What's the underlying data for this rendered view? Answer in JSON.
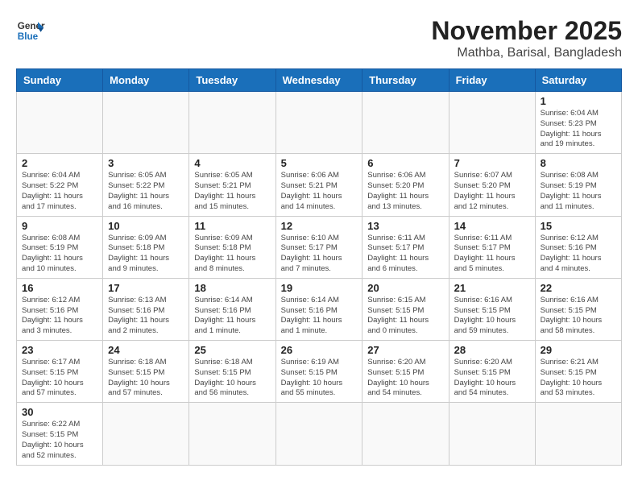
{
  "header": {
    "logo_general": "General",
    "logo_blue": "Blue",
    "title": "November 2025",
    "subtitle": "Mathba, Barisal, Bangladesh"
  },
  "weekdays": [
    "Sunday",
    "Monday",
    "Tuesday",
    "Wednesday",
    "Thursday",
    "Friday",
    "Saturday"
  ],
  "weeks": [
    [
      {
        "day": "",
        "info": ""
      },
      {
        "day": "",
        "info": ""
      },
      {
        "day": "",
        "info": ""
      },
      {
        "day": "",
        "info": ""
      },
      {
        "day": "",
        "info": ""
      },
      {
        "day": "",
        "info": ""
      },
      {
        "day": "1",
        "info": "Sunrise: 6:04 AM\nSunset: 5:23 PM\nDaylight: 11 hours\nand 19 minutes."
      }
    ],
    [
      {
        "day": "2",
        "info": "Sunrise: 6:04 AM\nSunset: 5:22 PM\nDaylight: 11 hours\nand 17 minutes."
      },
      {
        "day": "3",
        "info": "Sunrise: 6:05 AM\nSunset: 5:22 PM\nDaylight: 11 hours\nand 16 minutes."
      },
      {
        "day": "4",
        "info": "Sunrise: 6:05 AM\nSunset: 5:21 PM\nDaylight: 11 hours\nand 15 minutes."
      },
      {
        "day": "5",
        "info": "Sunrise: 6:06 AM\nSunset: 5:21 PM\nDaylight: 11 hours\nand 14 minutes."
      },
      {
        "day": "6",
        "info": "Sunrise: 6:06 AM\nSunset: 5:20 PM\nDaylight: 11 hours\nand 13 minutes."
      },
      {
        "day": "7",
        "info": "Sunrise: 6:07 AM\nSunset: 5:20 PM\nDaylight: 11 hours\nand 12 minutes."
      },
      {
        "day": "8",
        "info": "Sunrise: 6:08 AM\nSunset: 5:19 PM\nDaylight: 11 hours\nand 11 minutes."
      }
    ],
    [
      {
        "day": "9",
        "info": "Sunrise: 6:08 AM\nSunset: 5:19 PM\nDaylight: 11 hours\nand 10 minutes."
      },
      {
        "day": "10",
        "info": "Sunrise: 6:09 AM\nSunset: 5:18 PM\nDaylight: 11 hours\nand 9 minutes."
      },
      {
        "day": "11",
        "info": "Sunrise: 6:09 AM\nSunset: 5:18 PM\nDaylight: 11 hours\nand 8 minutes."
      },
      {
        "day": "12",
        "info": "Sunrise: 6:10 AM\nSunset: 5:17 PM\nDaylight: 11 hours\nand 7 minutes."
      },
      {
        "day": "13",
        "info": "Sunrise: 6:11 AM\nSunset: 5:17 PM\nDaylight: 11 hours\nand 6 minutes."
      },
      {
        "day": "14",
        "info": "Sunrise: 6:11 AM\nSunset: 5:17 PM\nDaylight: 11 hours\nand 5 minutes."
      },
      {
        "day": "15",
        "info": "Sunrise: 6:12 AM\nSunset: 5:16 PM\nDaylight: 11 hours\nand 4 minutes."
      }
    ],
    [
      {
        "day": "16",
        "info": "Sunrise: 6:12 AM\nSunset: 5:16 PM\nDaylight: 11 hours\nand 3 minutes."
      },
      {
        "day": "17",
        "info": "Sunrise: 6:13 AM\nSunset: 5:16 PM\nDaylight: 11 hours\nand 2 minutes."
      },
      {
        "day": "18",
        "info": "Sunrise: 6:14 AM\nSunset: 5:16 PM\nDaylight: 11 hours\nand 1 minute."
      },
      {
        "day": "19",
        "info": "Sunrise: 6:14 AM\nSunset: 5:16 PM\nDaylight: 11 hours\nand 1 minute."
      },
      {
        "day": "20",
        "info": "Sunrise: 6:15 AM\nSunset: 5:15 PM\nDaylight: 11 hours\nand 0 minutes."
      },
      {
        "day": "21",
        "info": "Sunrise: 6:16 AM\nSunset: 5:15 PM\nDaylight: 10 hours\nand 59 minutes."
      },
      {
        "day": "22",
        "info": "Sunrise: 6:16 AM\nSunset: 5:15 PM\nDaylight: 10 hours\nand 58 minutes."
      }
    ],
    [
      {
        "day": "23",
        "info": "Sunrise: 6:17 AM\nSunset: 5:15 PM\nDaylight: 10 hours\nand 57 minutes."
      },
      {
        "day": "24",
        "info": "Sunrise: 6:18 AM\nSunset: 5:15 PM\nDaylight: 10 hours\nand 57 minutes."
      },
      {
        "day": "25",
        "info": "Sunrise: 6:18 AM\nSunset: 5:15 PM\nDaylight: 10 hours\nand 56 minutes."
      },
      {
        "day": "26",
        "info": "Sunrise: 6:19 AM\nSunset: 5:15 PM\nDaylight: 10 hours\nand 55 minutes."
      },
      {
        "day": "27",
        "info": "Sunrise: 6:20 AM\nSunset: 5:15 PM\nDaylight: 10 hours\nand 54 minutes."
      },
      {
        "day": "28",
        "info": "Sunrise: 6:20 AM\nSunset: 5:15 PM\nDaylight: 10 hours\nand 54 minutes."
      },
      {
        "day": "29",
        "info": "Sunrise: 6:21 AM\nSunset: 5:15 PM\nDaylight: 10 hours\nand 53 minutes."
      }
    ],
    [
      {
        "day": "30",
        "info": "Sunrise: 6:22 AM\nSunset: 5:15 PM\nDaylight: 10 hours\nand 52 minutes."
      },
      {
        "day": "",
        "info": ""
      },
      {
        "day": "",
        "info": ""
      },
      {
        "day": "",
        "info": ""
      },
      {
        "day": "",
        "info": ""
      },
      {
        "day": "",
        "info": ""
      },
      {
        "day": "",
        "info": ""
      }
    ]
  ]
}
